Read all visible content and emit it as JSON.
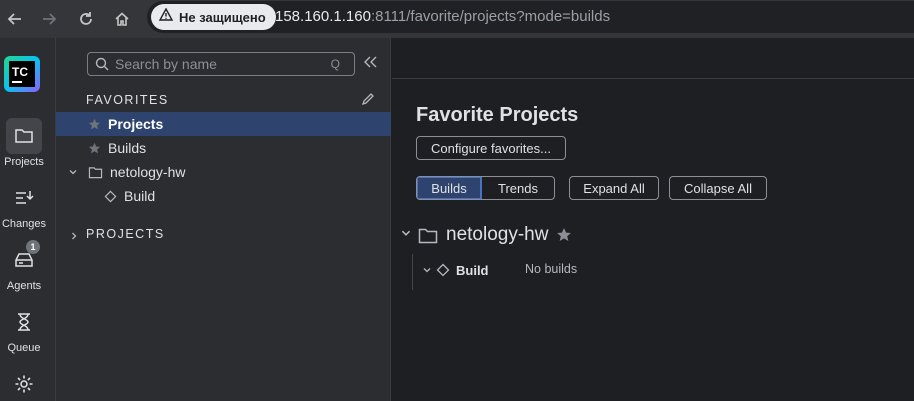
{
  "browser": {
    "security_label": "Не защищено",
    "url_host": "158.160.1.160",
    "url_rest": ":8111/favorite/projects?mode=builds",
    "icons": [
      "back-icon",
      "forward-icon",
      "reload-icon",
      "home-icon",
      "warning-icon"
    ]
  },
  "rail": {
    "logo_text": "TC",
    "items": [
      {
        "label": "Projects",
        "icon": "folder-icon",
        "active": true
      },
      {
        "label": "Changes",
        "icon": "changes-icon"
      },
      {
        "label": "Agents",
        "icon": "agents-icon",
        "badge": "1"
      },
      {
        "label": "Queue",
        "icon": "hourglass-icon"
      },
      {
        "label": "",
        "icon": "gear-icon"
      }
    ]
  },
  "sidebar": {
    "search_placeholder": "Search by name",
    "search_hotkey": "Q",
    "favorites_title": "FAVORITES",
    "projects_title": "PROJECTS",
    "tree": [
      {
        "label": "Projects",
        "icon": "star-icon",
        "selected": true
      },
      {
        "label": "Builds",
        "icon": "star-icon"
      },
      {
        "label": "netology-hw",
        "icon": "folder-icon",
        "expanded": true
      },
      {
        "label": "Build",
        "icon": "diamond-icon"
      }
    ]
  },
  "main": {
    "title": "Favorite Projects",
    "configure_label": "Configure favorites...",
    "tabs": [
      {
        "label": "Builds",
        "active": true
      },
      {
        "label": "Trends"
      }
    ],
    "expand_all": "Expand All",
    "collapse_all": "Collapse All",
    "project": {
      "name": "netology-hw",
      "build": {
        "name": "Build",
        "status": "No builds"
      }
    }
  },
  "colors": {
    "accent": "#2e436e",
    "accent_border": "#4b71c4",
    "background": "#1e1f22",
    "panel": "#2b2d30"
  }
}
